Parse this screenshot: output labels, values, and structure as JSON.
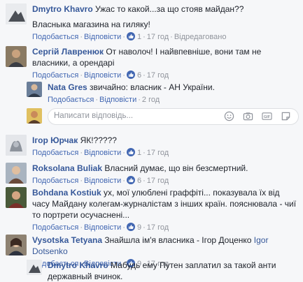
{
  "labels": {
    "like": "Подобається",
    "reply": "Відповісти",
    "edited": "Відредаговано",
    "reply_placeholder": "Написати відповідь..."
  },
  "icons": {
    "like": "thumbs-up-icon",
    "emoji": "smiley-icon",
    "camera": "camera-icon",
    "gif": "gif-icon",
    "sticker": "sticker-icon"
  },
  "comments": [
    {
      "name": "Dmytro Khavro",
      "text": "Ужас то какой...за що стояв майдан??",
      "text2": "Власныка магазина на гиляку!",
      "likes": "1",
      "time": "17 год",
      "edited": true
    },
    {
      "name": "Сергій Лавренюк",
      "text": "От наволоч! І найвпевніше, вони там не власники, а орендарі",
      "likes": "6",
      "time": "17 год"
    },
    {
      "name": "Nata Gres",
      "text": "звичайно: власник - АН України.",
      "likes": "",
      "time": "2 год"
    },
    {
      "name": "Ігор Юрчак",
      "text": "ЯК!?????",
      "likes": "1",
      "time": "17 год"
    },
    {
      "name": "Roksolana Buliak",
      "text": "Власний думає, що він безсмертний.",
      "likes": "6",
      "time": "17 год"
    },
    {
      "name": "Bohdana Kostiuk",
      "text": "ух, мої улюблені граффіті... показувала їх від часу Майдану колегам-журналістам з інших країн. пояснювала - чиї то портрети осучаснені...",
      "likes": "9",
      "time": "17 год"
    },
    {
      "name": "Vysotska Tetyana",
      "text": "Знайшла ім'я власника - Ігор Доценко",
      "mention": "Igor Dotsenko",
      "likes": "9",
      "time": "17 год"
    },
    {
      "name": "Dmytro Khavro",
      "text": "Мабудь ему Путен заплатил за такой анти державный вчинок."
    }
  ]
}
